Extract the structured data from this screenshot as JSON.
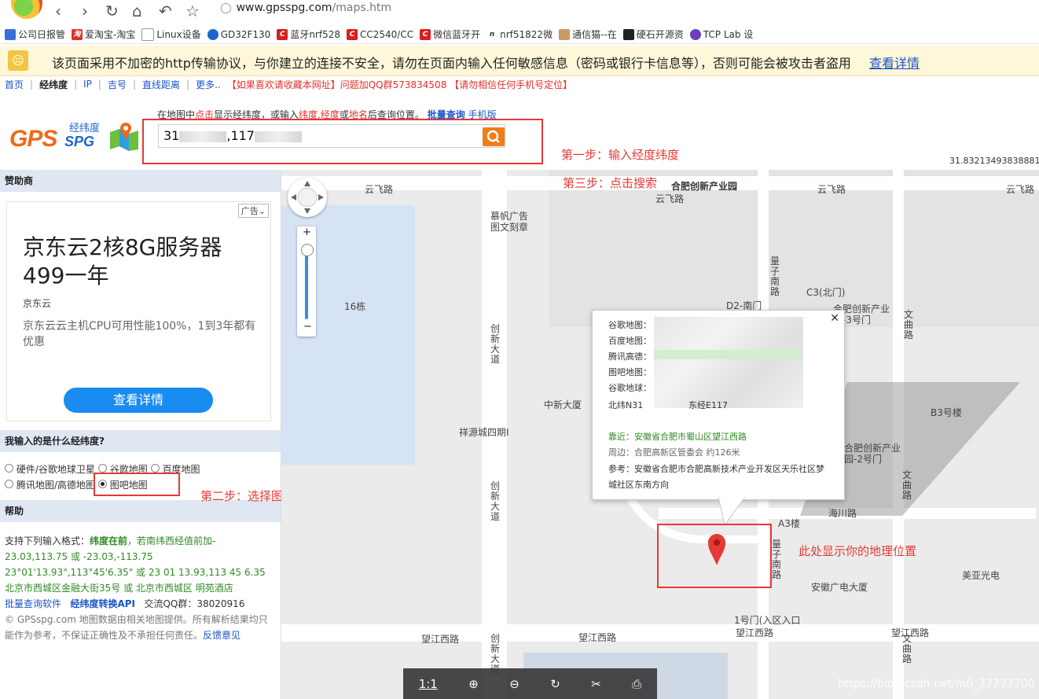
{
  "browser": {
    "url_host": "www.gpsspg.com",
    "url_path": "/maps.htm",
    "bookmarks": [
      "公司日报管",
      "爱淘宝-淘宝",
      "Linux设备",
      "GD32F130",
      "蓝牙nrf528",
      "CC2540/CC",
      "微信蓝牙开",
      "nrf51822微",
      "通信猫--在",
      "硬石开源资",
      "TCP Lab 设"
    ]
  },
  "security_bar": {
    "text": "该页面采用不加密的http传输协议，与你建立的连接不安全，请勿在页面内输入任何敏感信息（密码或银行卡信息等），否则可能会被攻击者盗用",
    "link": "查看详情"
  },
  "site_nav": {
    "items": [
      "首页",
      "经纬度",
      "IP",
      "吉号",
      "直线距离",
      "更多.."
    ],
    "promo": "【如果喜欢请收藏本网址】问题加QQ群573834508 【请勿相信任何手机号定位】"
  },
  "logo": {
    "gps": "GPS",
    "spg": "SPG",
    "cn": "经纬度"
  },
  "hint": {
    "p1": "在地图中",
    "p2": "点击",
    "p3": "显示经纬度，或输入",
    "p4": "纬度,经度",
    "p5": "或",
    "p6": "地名",
    "p7": "后查询位置。",
    "link1": "批量查询",
    "link2": "手机版"
  },
  "search": {
    "value_prefix": "31",
    "value_mid": ",117"
  },
  "coord_readout": "31.832134938388815",
  "annotations": {
    "step1": "第一步：输入经度纬度",
    "step2": "第二步：选择图吧地图",
    "step3": "第三步：点击搜索",
    "step4": "此处显示你的地理位置"
  },
  "sponsor": {
    "header": "赞助商",
    "tag": "广告",
    "title": "京东云2核8G服务器499一年",
    "brand": "京东云",
    "desc": "京东云云主机CPU可用性能100%，1到3年都有优惠",
    "button": "查看详情"
  },
  "coord_type": {
    "header": "我输入的是什么经纬度?",
    "options": [
      "硬件/谷歌地球卫星",
      "谷歌地图",
      "百度地图",
      "腾讯地图/高德地图",
      "图吧地图"
    ],
    "selected": "图吧地图"
  },
  "help": {
    "header": "帮助",
    "l1a": "支持下列输入格式：",
    "l1b": "纬度在前",
    "l1c": "，若南纬西经值前加-",
    "l2": "23.03,113.75 或 -23.03,-113.75",
    "l3": "23°01'13.93\",113°45'6.35\" 或 23 01 13.93,113 45 6.35",
    "l4": "北京市西城区金融大街35号 或 北京市西城区 明苑酒店",
    "l5a": "批量查询软件",
    "l5b": "经纬度转换API",
    "l5c": "交流QQ群：38020916",
    "l6": "© GPSspg.com 地图数据由相关地图提供。所有解析结果均只能作为参考，不保证正确性及不承担任何责任。",
    "l6link": "反馈意见"
  },
  "map": {
    "labels": [
      "云飞路",
      "云飞路",
      "云飞路",
      "云飞路",
      "合肥创新产业园",
      "慕帆广告图文刻章",
      "16栋",
      "D2-南门",
      "C3(北门)",
      "合肥创新产业园-3号门",
      "中新大厦",
      "祥源城四期I",
      "B3号楼",
      "合肥创新产业园-2号门",
      "A3楼",
      "海川路",
      "安徽广电大厦",
      "美亚光电",
      "1号门(入区入口",
      "望江西路",
      "望江西路",
      "望江西路",
      "望江西路"
    ],
    "vlabels": [
      "量子南路",
      "创新大道",
      "创新大道",
      "文曲路",
      "文曲路",
      "量子南路",
      "创新大道",
      "文曲路"
    ]
  },
  "popup": {
    "rows": [
      "谷歌地图：",
      "百度地图：",
      "腾讯高德：",
      "图吧地图：",
      "谷歌地球：",
      "北纬N31",
      "东经E117"
    ],
    "near_label": "靠近：",
    "near": "安徽省合肥市蜀山区望江西路",
    "around_label": "周边：",
    "around": "合肥高新区管委会 约126米",
    "ref_label": "参考：",
    "ref": "安徽省合肥市合肥高新技术产业开发区天乐社区梦城社区东南方向"
  },
  "viewer": {
    "ratio": "1:1"
  },
  "watermark": "https://blog.csdn.net/m0_37777700",
  "colors": {
    "accent_red": "#e53935",
    "link_blue": "#1a56c6",
    "brand_orange": "#f06a1a"
  }
}
